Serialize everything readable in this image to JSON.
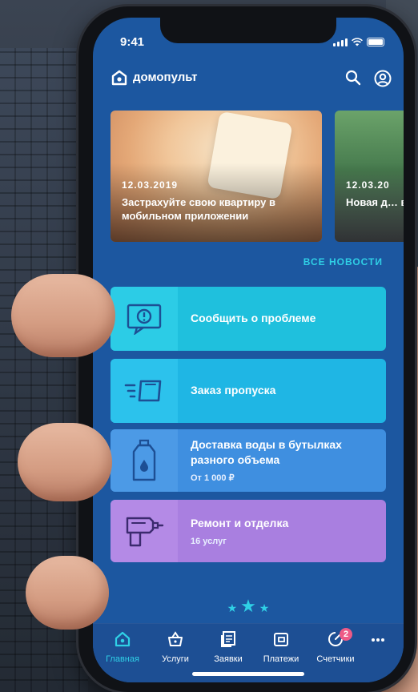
{
  "status": {
    "time": "9:41"
  },
  "app": {
    "name": "домопульт",
    "search_icon": "search-icon",
    "profile_icon": "profile-icon"
  },
  "news": [
    {
      "date": "12.03.2019",
      "title": "Застрахуйте свою квартиру в мобильном приложении"
    },
    {
      "date": "12.03.20",
      "title": "Новая д… в нашем…"
    }
  ],
  "all_news_label": "ВСЕ НОВОСТИ",
  "services": [
    {
      "title": "Сообщить о проблеме",
      "icon": "report-problem-icon",
      "color": "#1fc0dd"
    },
    {
      "title": "Заказ пропуска",
      "icon": "pass-icon",
      "color": "#1fb6e4"
    },
    {
      "title": "Доставка воды в бутылках разного объема",
      "subtitle": "От 1 000 ₽",
      "icon": "water-bottle-icon",
      "color": "#3f8fe0"
    },
    {
      "title": "Ремонт и отделка",
      "subtitle": "16 услуг",
      "icon": "drill-icon",
      "color": "#a97fe0"
    }
  ],
  "tabs": [
    {
      "label": "Главная",
      "icon": "home-icon",
      "active": true
    },
    {
      "label": "Услуги",
      "icon": "basket-icon"
    },
    {
      "label": "Заявки",
      "icon": "requests-icon"
    },
    {
      "label": "Платежи",
      "icon": "wallet-icon"
    },
    {
      "label": "Счетчики",
      "icon": "meter-icon",
      "badge": "2"
    },
    {
      "label": "",
      "icon": "more-icon"
    }
  ],
  "colors": {
    "background": "#1c57a0",
    "accent": "#2fd0e6",
    "badge": "#ee5a86"
  }
}
